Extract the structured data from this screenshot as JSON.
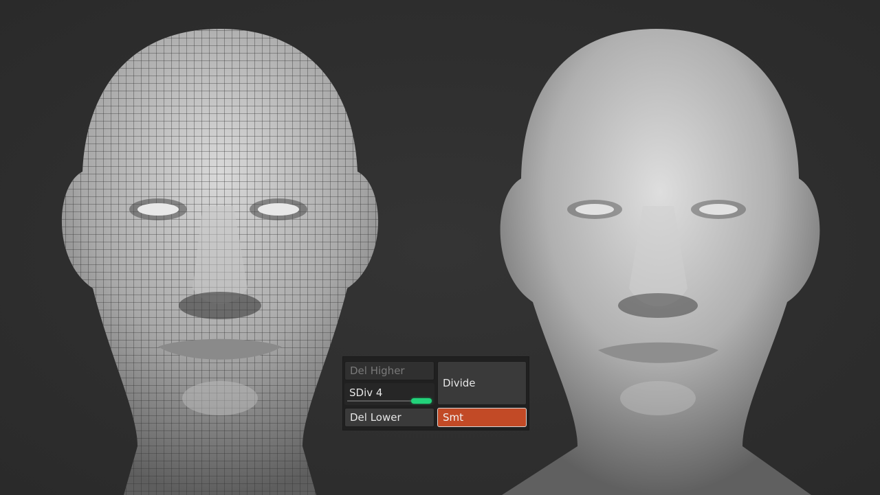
{
  "subdivision_panel": {
    "del_higher_label": "Del Higher",
    "divide_label": "Divide",
    "sdiv_label": "SDiv 4",
    "sdiv_level_fraction": 1.0,
    "del_lower_label": "Del Lower",
    "smt_label": "Smt"
  },
  "colors": {
    "background": "#2f2f2f",
    "slider_knob": "#22d27a",
    "smt_active": "#c24a26"
  }
}
